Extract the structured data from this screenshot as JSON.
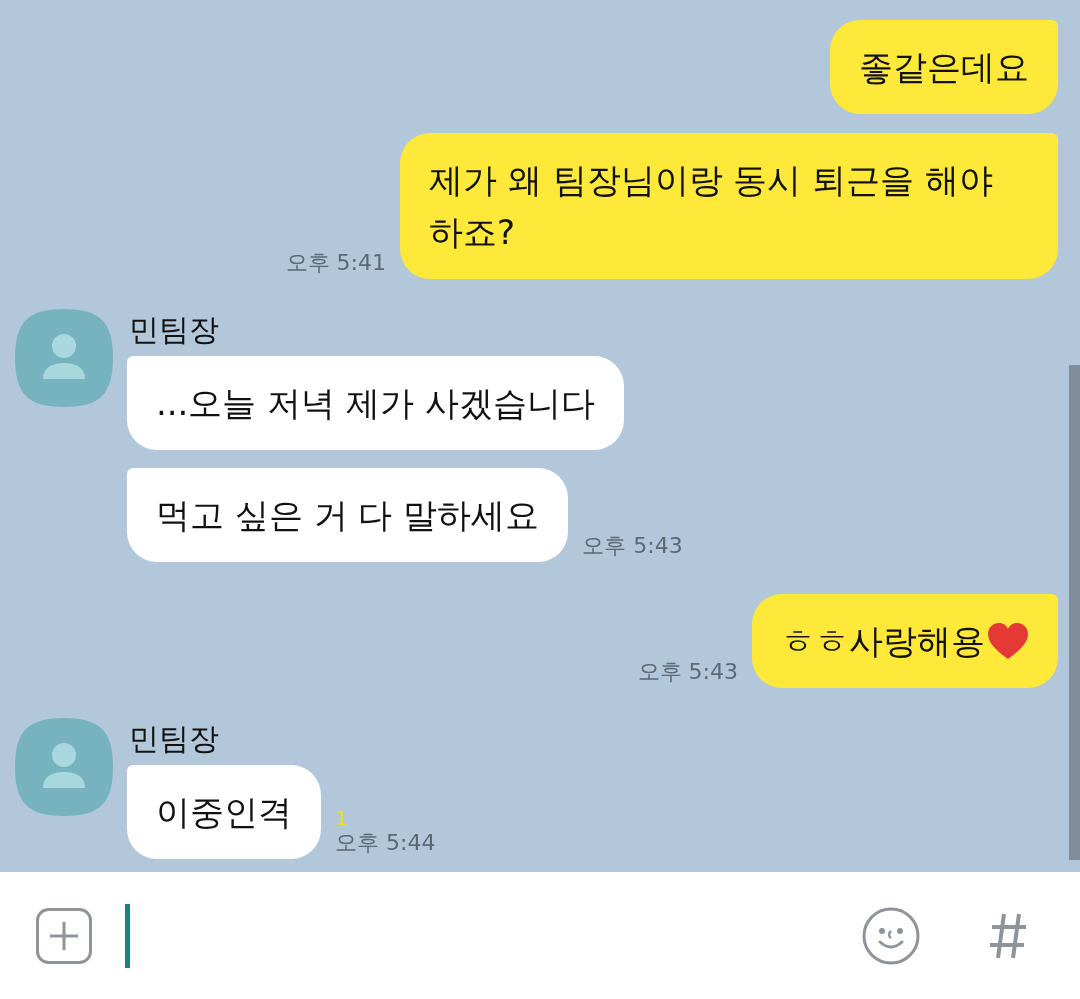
{
  "chat": {
    "groups": [
      {
        "kind": "sent",
        "bubbles": [
          {
            "text": "좋같은데요",
            "emoji": false
          },
          {
            "text": "제가 왜 팀장님이랑 동시 퇴근을 해야 하죠?",
            "emoji": false,
            "time": "오후 5:41"
          }
        ]
      },
      {
        "kind": "received",
        "sender": "민팀장",
        "bubbles": [
          {
            "text": "...오늘 저녁 제가 사겠습니다",
            "emoji": false
          },
          {
            "text": "먹고 싶은 거 다 말하세요",
            "emoji": false,
            "time": "오후 5:43"
          }
        ]
      },
      {
        "kind": "sent",
        "bubbles": [
          {
            "text": "ㅎㅎ사랑해용",
            "emoji": true,
            "time": "오후 5:43"
          }
        ]
      },
      {
        "kind": "received",
        "sender": "민팀장",
        "bubbles": [
          {
            "text": "이중인격",
            "emoji": false,
            "unread": "1",
            "time": "오후 5:44"
          }
        ]
      }
    ]
  },
  "composer": {
    "focused": true
  }
}
